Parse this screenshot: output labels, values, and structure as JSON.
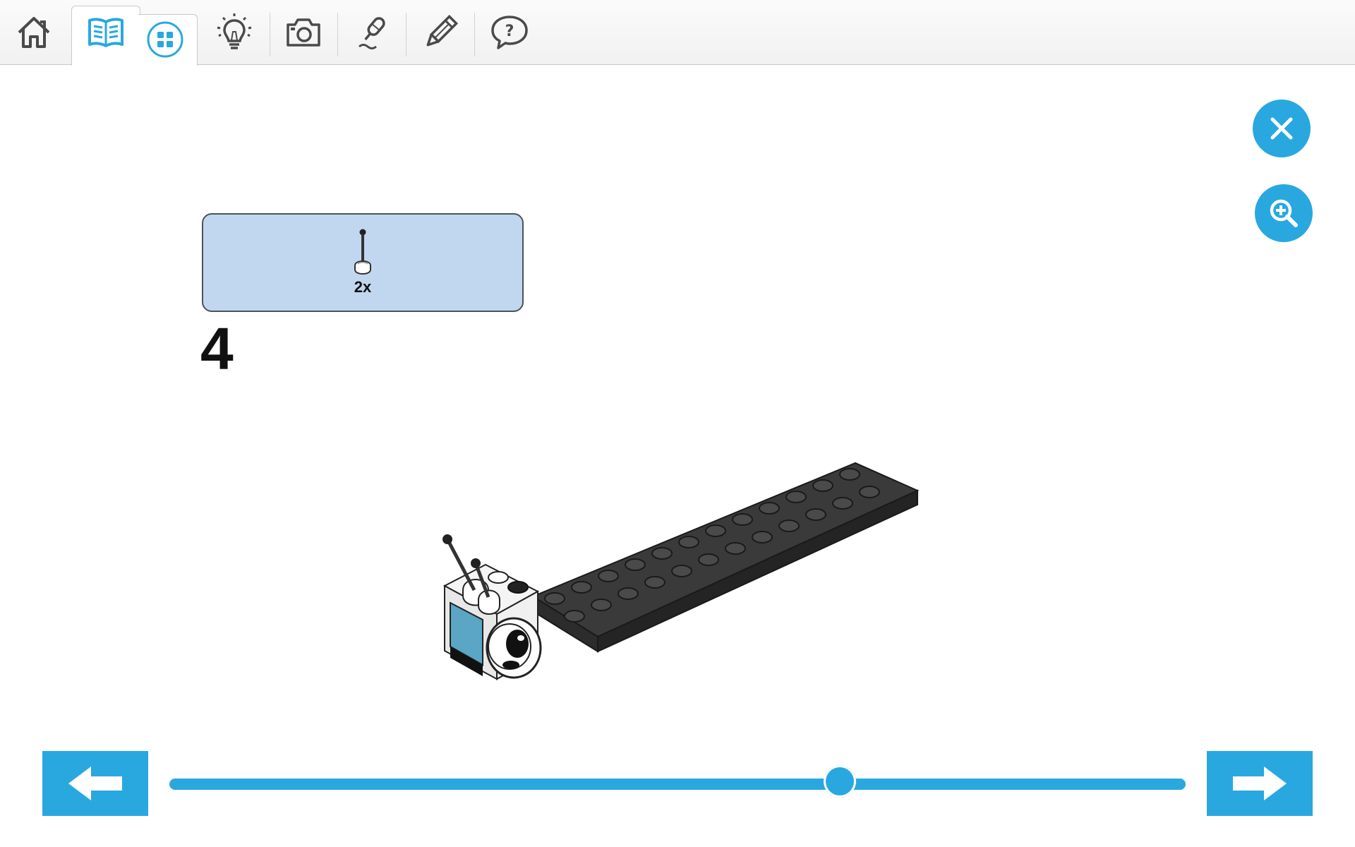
{
  "toolbar": {
    "items": [
      {
        "icon": "home-icon"
      },
      {
        "icon": "building-instructions-icon",
        "active": true
      },
      {
        "icon": "overview-grid-icon"
      },
      {
        "icon": "lightbulb-icon"
      },
      {
        "icon": "camera-icon"
      },
      {
        "icon": "microphone-icon"
      },
      {
        "icon": "pencil-icon"
      },
      {
        "icon": "help-chat-icon"
      }
    ]
  },
  "actions": {
    "close_icon": "close-icon",
    "zoom_icon": "zoom-in-icon"
  },
  "parts_callout": {
    "quantity": "2x",
    "part": "antenna-stick-icon"
  },
  "step": {
    "number": "4"
  },
  "navigation": {
    "prev_icon": "arrow-left-icon",
    "next_icon": "arrow-right-icon"
  },
  "progress": {
    "value": 0.66
  },
  "colors": {
    "accent": "#29a8e0",
    "callout_bg": "#c1d7ef",
    "brick_dark": "#3a3a3a"
  }
}
